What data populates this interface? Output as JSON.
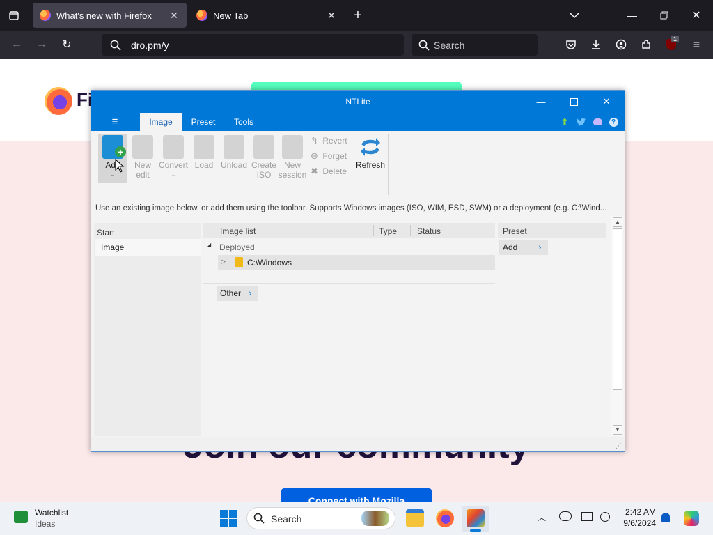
{
  "browser": {
    "tabs": [
      {
        "title": "What's new with Firefox",
        "active": true
      },
      {
        "title": "New Tab",
        "active": false
      }
    ],
    "url": "dro.pm/y",
    "search_placeholder": "Search",
    "extension_badge": "1"
  },
  "page": {
    "brand": "Fi",
    "heading": "Join our community",
    "cta": "Connect with Mozilla"
  },
  "ntlite": {
    "title": "NTLite",
    "tabs": [
      "Image",
      "Preset",
      "Tools"
    ],
    "ribbon": {
      "add": "Add",
      "new_edit": [
        "New",
        "edit"
      ],
      "convert": "Convert",
      "load": "Load",
      "unload": "Unload",
      "create_iso": [
        "Create",
        "ISO"
      ],
      "new_session": [
        "New",
        "session"
      ],
      "revert": "Revert",
      "forget": "Forget",
      "delete": "Delete",
      "refresh": "Refresh"
    },
    "hint": "Use an existing image below, or add them using the toolbar. Supports Windows images (ISO, WIM, ESD, SWM) or a deployment (e.g. C:\\Wind...",
    "start": {
      "header": "Start",
      "items": [
        "Image"
      ]
    },
    "image_list": {
      "headers": [
        "Image list",
        "Type",
        "Status"
      ],
      "groups": [
        {
          "name": "Deployed",
          "items": [
            "C:\\Windows"
          ]
        }
      ],
      "other": "Other"
    },
    "preset": {
      "header": "Preset",
      "add": "Add"
    }
  },
  "taskbar": {
    "widget_title": "Watchlist",
    "widget_sub": "Ideas",
    "search": "Search",
    "time": "2:42 AM",
    "date": "9/6/2024"
  }
}
